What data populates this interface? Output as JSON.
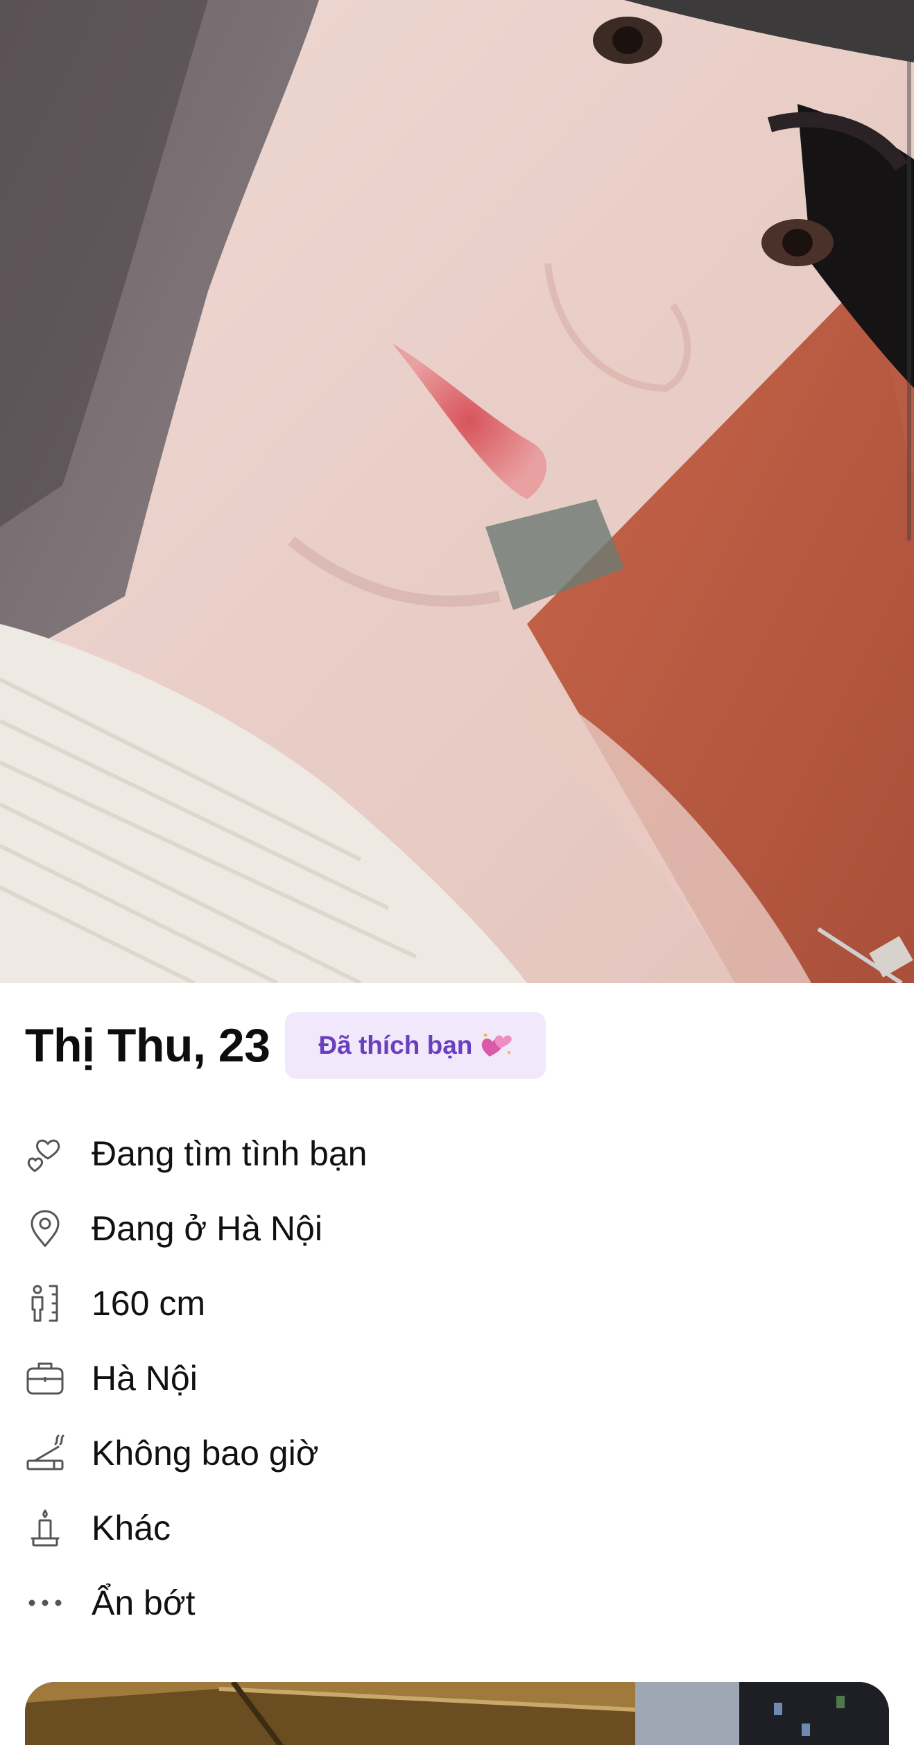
{
  "profile": {
    "name_age": "Thị Thu, 23",
    "liked_badge": {
      "label": "Đã thích bạn",
      "emoji_icon": "sparkling-two-hearts-icon",
      "bg_color": "#f1e9fb",
      "text_color": "#6a3fbf"
    }
  },
  "attributes": [
    {
      "icon": "hearts-outline-icon",
      "label": "Đang tìm tình bạn"
    },
    {
      "icon": "location-pin-icon",
      "label": "Đang ở Hà Nội"
    },
    {
      "icon": "height-ruler-icon",
      "label": "160 cm"
    },
    {
      "icon": "briefcase-icon",
      "label": "Hà Nội"
    },
    {
      "icon": "smoking-icon",
      "label": "Không bao giờ"
    },
    {
      "icon": "religion-candle-icon",
      "label": "Khác"
    },
    {
      "icon": "more-dots-icon",
      "label": "Ẩn bớt"
    }
  ]
}
